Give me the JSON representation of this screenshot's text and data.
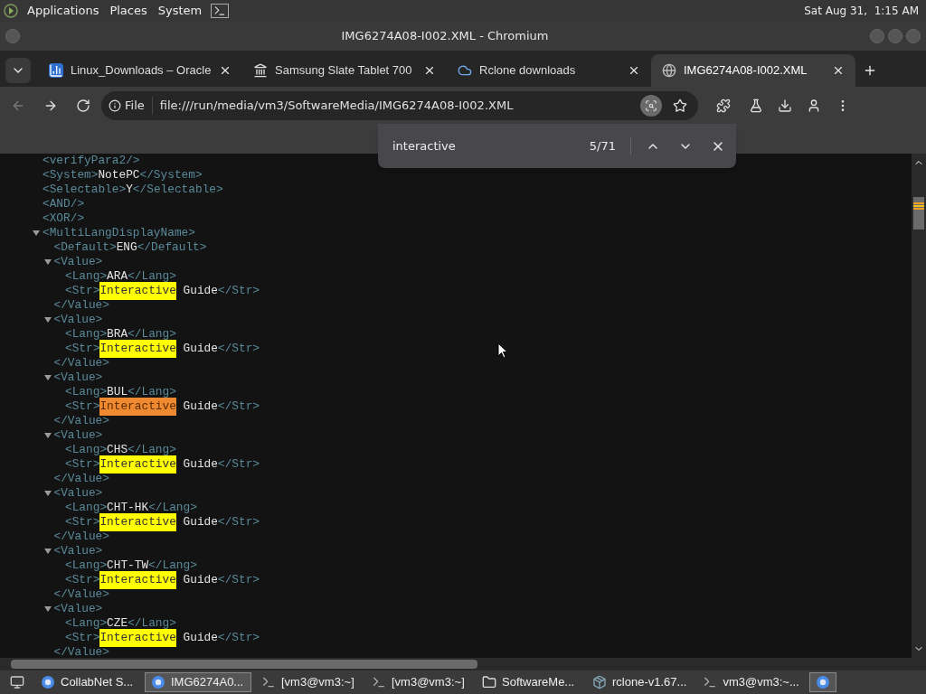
{
  "top_panel": {
    "menus": [
      "Applications",
      "Places",
      "System"
    ],
    "clock": "Sat Aug 31,  1:15 AM"
  },
  "window": {
    "title": "IMG6274A08-I002.XML - Chromium"
  },
  "tabs": [
    {
      "label": "Linux_Downloads – Oracle",
      "kind": "chart",
      "selected": false
    },
    {
      "label": "Samsung Slate Tablet 700",
      "kind": "bank",
      "selected": false
    },
    {
      "label": "Rclone downloads",
      "kind": "cloud",
      "selected": false
    },
    {
      "label": "IMG6274A08-I002.XML",
      "kind": "globe",
      "selected": true
    }
  ],
  "toolbar": {
    "back_disabled": true,
    "scheme_chip": "File",
    "url": "file:///run/media/vm3/SoftwareMedia/IMG6274A08-I002.XML"
  },
  "find_bar": {
    "query": "interactive",
    "count": "5/71"
  },
  "xml": [
    {
      "kind": "empty",
      "tag": "<verifyPara2/>"
    },
    {
      "kind": "leaf",
      "open": "<System>",
      "text": "NotePC",
      "close": "</System>"
    },
    {
      "kind": "leaf",
      "open": "<Selectable>",
      "text": "Y",
      "close": "</Selectable>"
    },
    {
      "kind": "empty",
      "tag": "<AND/>"
    },
    {
      "kind": "empty",
      "tag": "<XOR/>"
    },
    {
      "kind": "element",
      "open": "<MultiLangDisplayName>",
      "expanded": true,
      "children": [
        {
          "kind": "leaf",
          "open": "<Default>",
          "text": "ENG",
          "close": "</Default>"
        },
        {
          "kind": "element",
          "open": "<Value>",
          "close": "</Value>",
          "expanded": true,
          "children": [
            {
              "kind": "leaf",
              "open": "<Lang>",
              "text": "ARA",
              "close": "</Lang>"
            },
            {
              "kind": "match",
              "open": "<Str>",
              "match": "Interactive",
              "current": false,
              "rest": " Guide",
              "close": "</Str>"
            }
          ]
        },
        {
          "kind": "element",
          "open": "<Value>",
          "close": "</Value>",
          "expanded": true,
          "children": [
            {
              "kind": "leaf",
              "open": "<Lang>",
              "text": "BRA",
              "close": "</Lang>"
            },
            {
              "kind": "match",
              "open": "<Str>",
              "match": "Interactive",
              "current": false,
              "rest": " Guide",
              "close": "</Str>"
            }
          ]
        },
        {
          "kind": "element",
          "open": "<Value>",
          "close": "</Value>",
          "expanded": true,
          "children": [
            {
              "kind": "leaf",
              "open": "<Lang>",
              "text": "BUL",
              "close": "</Lang>"
            },
            {
              "kind": "match",
              "open": "<Str>",
              "match": "Interactive",
              "current": true,
              "rest": " Guide",
              "close": "</Str>"
            }
          ]
        },
        {
          "kind": "element",
          "open": "<Value>",
          "close": "</Value>",
          "expanded": true,
          "children": [
            {
              "kind": "leaf",
              "open": "<Lang>",
              "text": "CHS",
              "close": "</Lang>"
            },
            {
              "kind": "match",
              "open": "<Str>",
              "match": "Interactive",
              "current": false,
              "rest": " Guide",
              "close": "</Str>"
            }
          ]
        },
        {
          "kind": "element",
          "open": "<Value>",
          "close": "</Value>",
          "expanded": true,
          "children": [
            {
              "kind": "leaf",
              "open": "<Lang>",
              "text": "CHT-HK",
              "close": "</Lang>"
            },
            {
              "kind": "match",
              "open": "<Str>",
              "match": "Interactive",
              "current": false,
              "rest": " Guide",
              "close": "</Str>"
            }
          ]
        },
        {
          "kind": "element",
          "open": "<Value>",
          "close": "</Value>",
          "expanded": true,
          "children": [
            {
              "kind": "leaf",
              "open": "<Lang>",
              "text": "CHT-TW",
              "close": "</Lang>"
            },
            {
              "kind": "match",
              "open": "<Str>",
              "match": "Interactive",
              "current": false,
              "rest": " Guide",
              "close": "</Str>"
            }
          ]
        },
        {
          "kind": "element",
          "open": "<Value>",
          "close": "</Value>",
          "expanded": true,
          "children": [
            {
              "kind": "leaf",
              "open": "<Lang>",
              "text": "CZE",
              "close": "</Lang>"
            },
            {
              "kind": "match",
              "open": "<Str>",
              "match": "Interactive",
              "current": false,
              "rest": " Guide",
              "close": "</Str>"
            }
          ]
        }
      ]
    }
  ],
  "taskbar": [
    {
      "kind": "desktop",
      "selected": false
    },
    {
      "kind": "browser",
      "label": "CollabNet S...",
      "selected": false
    },
    {
      "kind": "browser",
      "label": "IMG6274A0...",
      "selected": true
    },
    {
      "kind": "terminal",
      "label": "[vm3@vm3:~]",
      "selected": false
    },
    {
      "kind": "terminal",
      "label": "[vm3@vm3:~]",
      "selected": false
    },
    {
      "kind": "files",
      "label": "SoftwareMe...",
      "selected": false
    },
    {
      "kind": "package",
      "label": "rclone-v1.67...",
      "selected": false
    },
    {
      "kind": "terminal",
      "label": "vm3@vm3:~...",
      "selected": false
    },
    {
      "kind": "browser",
      "selected": true
    }
  ]
}
